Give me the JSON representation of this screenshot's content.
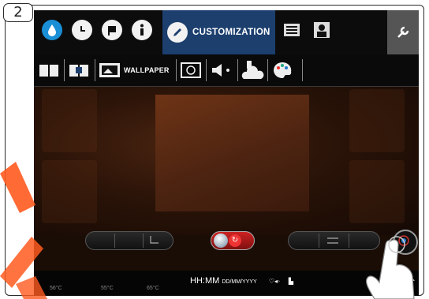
{
  "step": {
    "number": "2"
  },
  "top_nav": {
    "items": [
      {
        "name": "water-icon"
      },
      {
        "name": "clock-icon"
      },
      {
        "name": "flag-icon"
      },
      {
        "name": "info-icon"
      },
      {
        "name": "customization-tab",
        "label": "CUSTOMIZATION"
      },
      {
        "name": "cards-icon"
      },
      {
        "name": "user-icon"
      },
      {
        "name": "wrench-icon"
      }
    ],
    "active_color": "#1c3f6e"
  },
  "sub_nav": {
    "active_label": "WALLPAPER",
    "items": [
      "book-icon",
      "book-open-icon",
      "wallpaper-icon",
      "screensaver-icon",
      "volume-icon",
      "usb-cloud-icon",
      "palette-icon"
    ]
  },
  "status_bar": {
    "time": "HH:MM",
    "date": "DD/MM/YYYY",
    "temps": [
      "56°C",
      "55°C",
      "65°C"
    ]
  },
  "colors": {
    "highlight_arrow": "#ff5a1f",
    "toggle": "#c22222"
  }
}
